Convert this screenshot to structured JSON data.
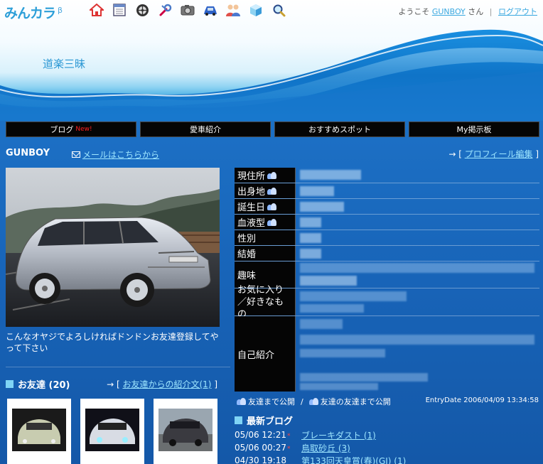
{
  "header": {
    "logo": "みんカラ",
    "logo_beta": "β",
    "nav_icons": [
      "home-icon",
      "calendar-icon",
      "wheel-icon",
      "wrench-icon",
      "camera-icon",
      "car-icon",
      "friends-icon",
      "cube-icon",
      "search-icon"
    ],
    "welcome_prefix": "ようこそ",
    "welcome_user": "GUNBOY",
    "welcome_suffix": "さん",
    "separator": "|",
    "logout": "ログアウト",
    "site_title": "道楽三昧"
  },
  "tabs": [
    {
      "label": "ブログ",
      "badge": "New!"
    },
    {
      "label": "愛車紹介"
    },
    {
      "label": "おすすめスポット"
    },
    {
      "label": "My掲示板"
    }
  ],
  "user": {
    "name": "GUNBOY",
    "mail_link": "メールはこちらから",
    "profile_prefix": "→ [",
    "profile_edit": "プロフィール編集",
    "profile_suffix": "]"
  },
  "caption": "こんなオヤジでよろしければドンドンお友達登録してやって下さい",
  "friends": {
    "title": "お友達 (20)",
    "link_prefix": "→ [",
    "link": "お友達からの紹介文(1)",
    "link_suffix": "]"
  },
  "profile": {
    "rows": [
      {
        "label": "現住所",
        "icon": true
      },
      {
        "label": "出身地",
        "icon": true
      },
      {
        "label": "誕生日",
        "icon": true
      },
      {
        "label": "血液型",
        "icon": true
      },
      {
        "label": "性別",
        "icon": false
      },
      {
        "label": "結婚",
        "icon": false
      },
      {
        "label": "趣味",
        "icon": false
      },
      {
        "label": "お気に入り／好きなもの",
        "icon": false
      },
      {
        "label": "自己紹介",
        "icon": false
      }
    ],
    "legend_friends": "友達まで公開",
    "legend_slash": "/",
    "legend_fof": "友達の友達まで公開",
    "entry_date": "EntryDate 2006/04/09 13:34:58"
  },
  "blog": {
    "title": "最新ブログ",
    "items": [
      {
        "date": "05/06 12:21",
        "star": "*",
        "title": "ブレーキダスト (1)"
      },
      {
        "date": "05/06 00:27",
        "star": "*",
        "title": "鳥取砂丘 (3)"
      },
      {
        "date": "04/30 19:18",
        "star": "",
        "title": "第133回天皇賞(春)(GI) (1)"
      }
    ]
  },
  "colors": {
    "tab_bg": "#050505",
    "link": "#9ee6ff",
    "new_badge": "#ff2020",
    "accent_square": "#7fd4f5"
  }
}
